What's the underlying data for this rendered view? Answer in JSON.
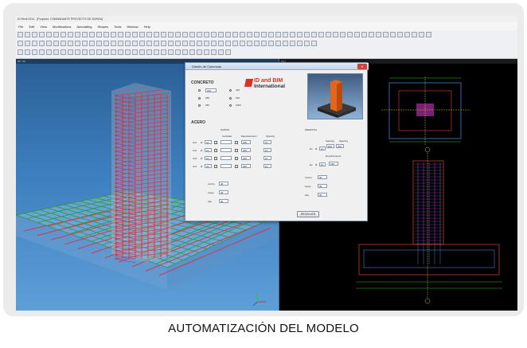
{
  "window": {
    "title": "ID Revit 2014 - [Proyecto: COMANDANTE PROYECTO DE ZAPATA]",
    "menu": [
      "File",
      "Edit",
      "View",
      "Modifications",
      "Annotating",
      "Shapes",
      "Tools",
      "Window",
      "Help"
    ]
  },
  "viewports": {
    "left_label": "3D : 3d",
    "right_label": "Plan"
  },
  "dialog": {
    "title": "Diseño de Columnas",
    "close": "X",
    "logo_line1": "ID and BIM",
    "logo_line2": "International",
    "concreto": "CONCRETO",
    "concrete_options": [
      "210",
      "280",
      "350",
      "420",
      "630",
      "1000"
    ],
    "acero": "ACERO",
    "zapata": "ZAPATA",
    "pedestal": "PEDESTAL",
    "col_headers": [
      "Cantidad",
      "Espaciamiento",
      "Spacing"
    ],
    "rows": [
      {
        "label": "Ac1",
        "diameter": "10",
        "spacing": "200",
        "value": "10"
      },
      {
        "label": "Ac2",
        "diameter": "10",
        "spacing": "200",
        "value": "10"
      },
      {
        "label": "Ac3",
        "diameter": "10",
        "spacing": "200",
        "value": "10"
      },
      {
        "label": "Ac4",
        "diameter": "10",
        "spacing": "200",
        "value": "10"
      }
    ],
    "pedestal_headers": [
      "Spacing",
      "Spacing"
    ],
    "pedestal_rows": [
      {
        "label": "Ex",
        "diameter": "10",
        "v1": "200",
        "v2": "200"
      },
      {
        "label": "Ey",
        "diameter": "10",
        "v1": "150",
        "v2": ""
      }
    ],
    "recubrimiento": "Recubrimiento",
    "bottom_left": [
      {
        "label": "Ancho",
        "value": "30"
      },
      {
        "label": "Largo",
        "value": "30"
      },
      {
        "label": "Alto",
        "value": "30"
      }
    ],
    "bottom_right": [
      {
        "label": "Ancho",
        "value": "50"
      },
      {
        "label": "Largo",
        "value": "50"
      },
      {
        "label": "Alto",
        "value": "50"
      }
    ],
    "button": "RESOLVER"
  },
  "caption": "AUTOMATIZACIÓN DEL MODELO",
  "colors": {
    "accent": "#d6322a",
    "rebar_red": "#d8354e",
    "rebar_green": "#2e9a4c",
    "cad_background": "#000000"
  }
}
